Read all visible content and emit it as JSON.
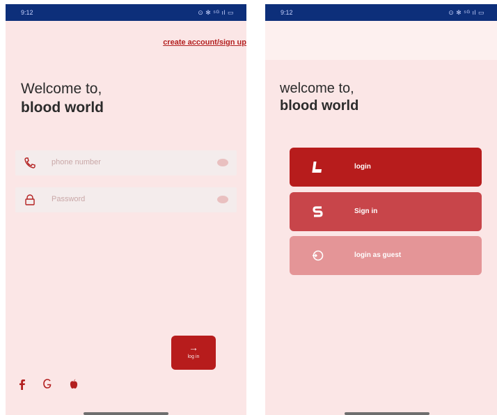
{
  "left_screen": {
    "status_bar": {
      "time": "9:12",
      "icons": "⊙ ✻ ⁵ᴳ ıl ▭"
    },
    "signup_link": "create account/sign up",
    "welcome_line1": "Welcome to,",
    "welcome_line2": "blood world",
    "phone_field": {
      "placeholder": "phone number",
      "icon": "phone-icon"
    },
    "password_field": {
      "placeholder": "Password",
      "icon": "lock-icon"
    },
    "login_button": {
      "arrow": "→",
      "label": "log in"
    },
    "social_icons": [
      "facebook-icon",
      "google-icon",
      "apple-icon"
    ]
  },
  "right_screen": {
    "status_bar": {
      "time": "9:12",
      "icons": "⊙ ✻ ⁵ᴳ ıl ▭"
    },
    "welcome_line1": "welcome to,",
    "welcome_line2": "blood world",
    "options": [
      {
        "label": "login",
        "icon": "login-icon"
      },
      {
        "label": "Sign in",
        "icon": "signin-icon"
      },
      {
        "label": "login as guest",
        "icon": "guest-icon"
      }
    ]
  },
  "colors": {
    "accent": "#b71c1c",
    "background": "#fbe6e6",
    "status_bar": "#0d2f7a",
    "signin_button": "#c8454a",
    "guest_button": "#e49597"
  }
}
